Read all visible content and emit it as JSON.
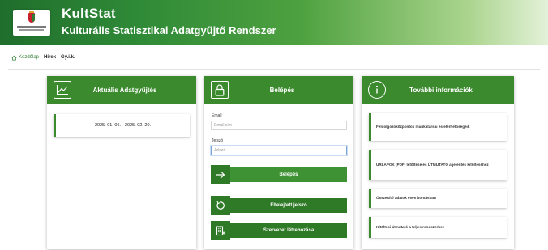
{
  "header": {
    "app_name": "KultStat",
    "app_subtitle": "Kulturális Statisztikai Adatgyűjtő Rendszer"
  },
  "nav": {
    "items": [
      {
        "label": "Kezdőlap",
        "icon": "home-icon"
      },
      {
        "label": "Hírek"
      },
      {
        "label": "Gy.i.k."
      }
    ]
  },
  "panels": {
    "current": {
      "title": "Aktuális Adatgyűjtés",
      "icon": "chart-icon",
      "date_range": "2025. 01. 06. - 2025. 02. 20."
    },
    "login": {
      "title": "Belépés",
      "icon": "lock-icon",
      "email_label": "Email",
      "email_placeholder": "Email cím",
      "password_label": "Jelszó",
      "password_placeholder": "Jelszó",
      "login_button": "Belépés",
      "forgot_button": "Elfelejtett jelszó",
      "create_org_button": "Szervezet létrehozása"
    },
    "info": {
      "title": "További információk",
      "icon": "info-icon",
      "links": [
        "Feldolgozóközpontok munkatársai és elérhetőségeik",
        "ŰRLAPOK (PDF) letöltése és ÚTMUTATÓ a jelentés kitöltéséhez",
        "Összesítő adatok éves bontásban",
        "Kitöltési útmutató a teljes rendszerhez"
      ]
    }
  },
  "colors": {
    "primary_green": "#3b8a2e",
    "dark_green": "#2f7a27",
    "header_gradient_start": "#1f6e2c",
    "header_gradient_end": "#e3f1d8"
  }
}
